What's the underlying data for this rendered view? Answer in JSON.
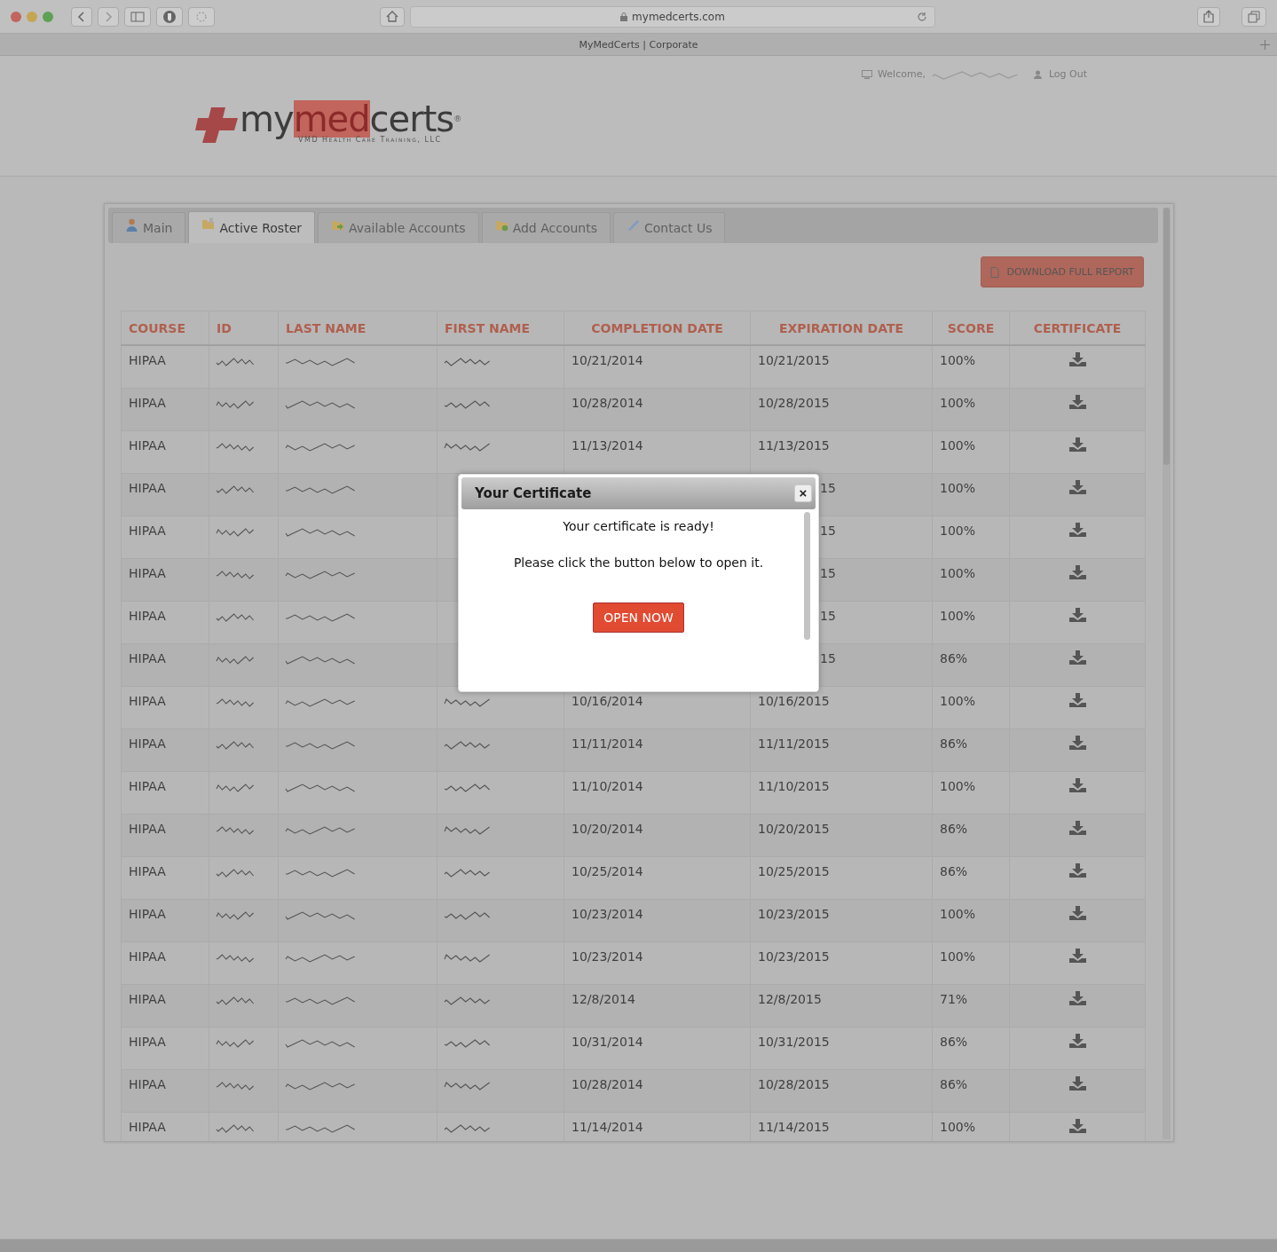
{
  "browser": {
    "url": "mymedcerts.com",
    "tab_title": "MyMedCerts | Corporate"
  },
  "header": {
    "welcome": "Welcome,",
    "logout": "Log Out",
    "logo": {
      "segments": [
        {
          "text": "my",
          "kind": "dark"
        },
        {
          "text": "med",
          "kind": "red"
        },
        {
          "text": "certs",
          "kind": "dark"
        }
      ],
      "mark": "®",
      "tagline": "VMD Health Care Training, LLC"
    }
  },
  "tabs": [
    {
      "label": "Main",
      "selected": false
    },
    {
      "label": "Active Roster",
      "selected": true
    },
    {
      "label": "Available Accounts",
      "selected": false
    },
    {
      "label": "Add Accounts",
      "selected": false
    },
    {
      "label": "Contact Us",
      "selected": false
    }
  ],
  "report_button": "DOWNLOAD FULL REPORT",
  "table": {
    "columns": [
      "COURSE",
      "ID",
      "LAST NAME",
      "FIRST NAME",
      "COMPLETION DATE",
      "EXPIRATION DATE",
      "SCORE",
      "CERTIFICATE"
    ],
    "rows": [
      {
        "course": "HIPAA",
        "completion": "10/21/2014",
        "expiration": "10/21/2015",
        "score": "100%"
      },
      {
        "course": "HIPAA",
        "completion": "10/28/2014",
        "expiration": "10/28/2015",
        "score": "100%"
      },
      {
        "course": "HIPAA",
        "completion": "11/13/2014",
        "expiration": "11/13/2015",
        "score": "100%"
      },
      {
        "course": "HIPAA",
        "expiration": "15",
        "score": "100%"
      },
      {
        "course": "HIPAA",
        "expiration": "15",
        "score": "100%"
      },
      {
        "course": "HIPAA",
        "expiration": "15",
        "score": "100%"
      },
      {
        "course": "HIPAA",
        "expiration": "15",
        "score": "100%"
      },
      {
        "course": "HIPAA",
        "expiration": "15",
        "score": "86%"
      },
      {
        "course": "HIPAA",
        "completion": "10/16/2014",
        "expiration": "10/16/2015",
        "score": "100%"
      },
      {
        "course": "HIPAA",
        "completion": "11/11/2014",
        "expiration": "11/11/2015",
        "score": "86%"
      },
      {
        "course": "HIPAA",
        "completion": "11/10/2014",
        "expiration": "11/10/2015",
        "score": "100%"
      },
      {
        "course": "HIPAA",
        "completion": "10/20/2014",
        "expiration": "10/20/2015",
        "score": "86%"
      },
      {
        "course": "HIPAA",
        "completion": "10/25/2014",
        "expiration": "10/25/2015",
        "score": "86%"
      },
      {
        "course": "HIPAA",
        "completion": "10/23/2014",
        "expiration": "10/23/2015",
        "score": "100%"
      },
      {
        "course": "HIPAA",
        "completion": "10/23/2014",
        "expiration": "10/23/2015",
        "score": "100%"
      },
      {
        "course": "HIPAA",
        "completion": "12/8/2014",
        "expiration": "12/8/2015",
        "score": "71%"
      },
      {
        "course": "HIPAA",
        "completion": "10/31/2014",
        "expiration": "10/31/2015",
        "score": "86%"
      },
      {
        "course": "HIPAA",
        "completion": "10/28/2014",
        "expiration": "10/28/2015",
        "score": "86%"
      },
      {
        "course": "HIPAA",
        "completion": "11/14/2014",
        "expiration": "11/14/2015",
        "score": "100%"
      }
    ]
  },
  "dialog": {
    "title": "Your Certificate",
    "close": "×",
    "message": "Your certificate is ready!",
    "instruction": "Please click the button below to open it.",
    "button": "OPEN NOW"
  }
}
